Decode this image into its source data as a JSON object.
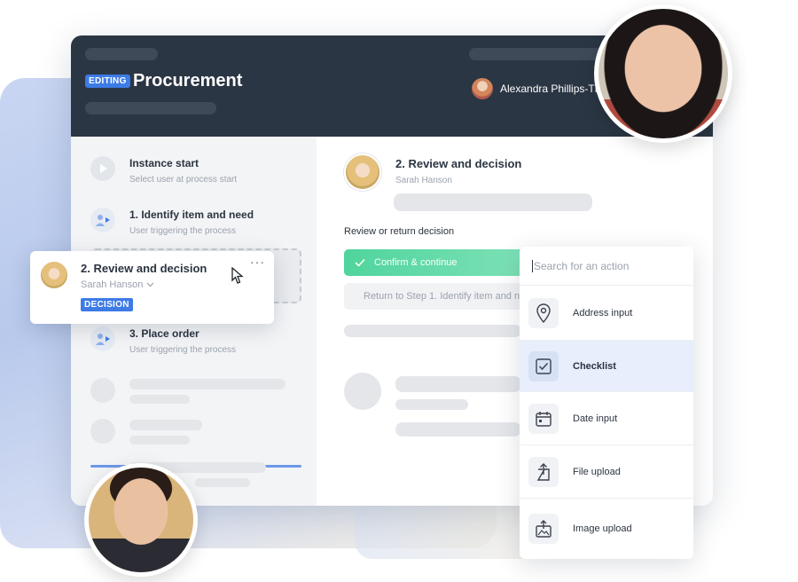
{
  "header": {
    "badge": "EDITING",
    "title": "Procurement",
    "user_name": "Alexandra Phillips-Tho"
  },
  "sidebar": {
    "steps": [
      {
        "title": "Instance start",
        "subtitle": "Select user at process start"
      },
      {
        "title": "1. Identify item and need",
        "subtitle": "User triggering the process"
      },
      {
        "title": "3. Place order",
        "subtitle": "User triggering the process"
      }
    ]
  },
  "drag_card": {
    "title": "2. Review and decision",
    "assignee": "Sarah Hanson",
    "badge": "DECISION",
    "menu": "···"
  },
  "main": {
    "step_title": "2. Review and decision",
    "assignee": "Sarah Hanson",
    "decision_label": "Review or return decision",
    "confirm_label": "Confirm & continue",
    "return_label": "Return to Step 1. Identify item and need"
  },
  "actions": {
    "search_placeholder": "Search for an action",
    "items": [
      {
        "label": "Address input",
        "icon": "location-pin-icon"
      },
      {
        "label": "Checklist",
        "icon": "checkbox-icon",
        "selected": true
      },
      {
        "label": "Date input",
        "icon": "calendar-icon"
      },
      {
        "label": "File upload",
        "icon": "file-upload-icon"
      },
      {
        "label": "Image upload",
        "icon": "image-upload-icon"
      }
    ]
  },
  "colors": {
    "header_bg": "#2b3644",
    "accent_blue": "#3d7be6",
    "confirm_green": "#4fd49c",
    "selected_row": "#e8eefb"
  }
}
